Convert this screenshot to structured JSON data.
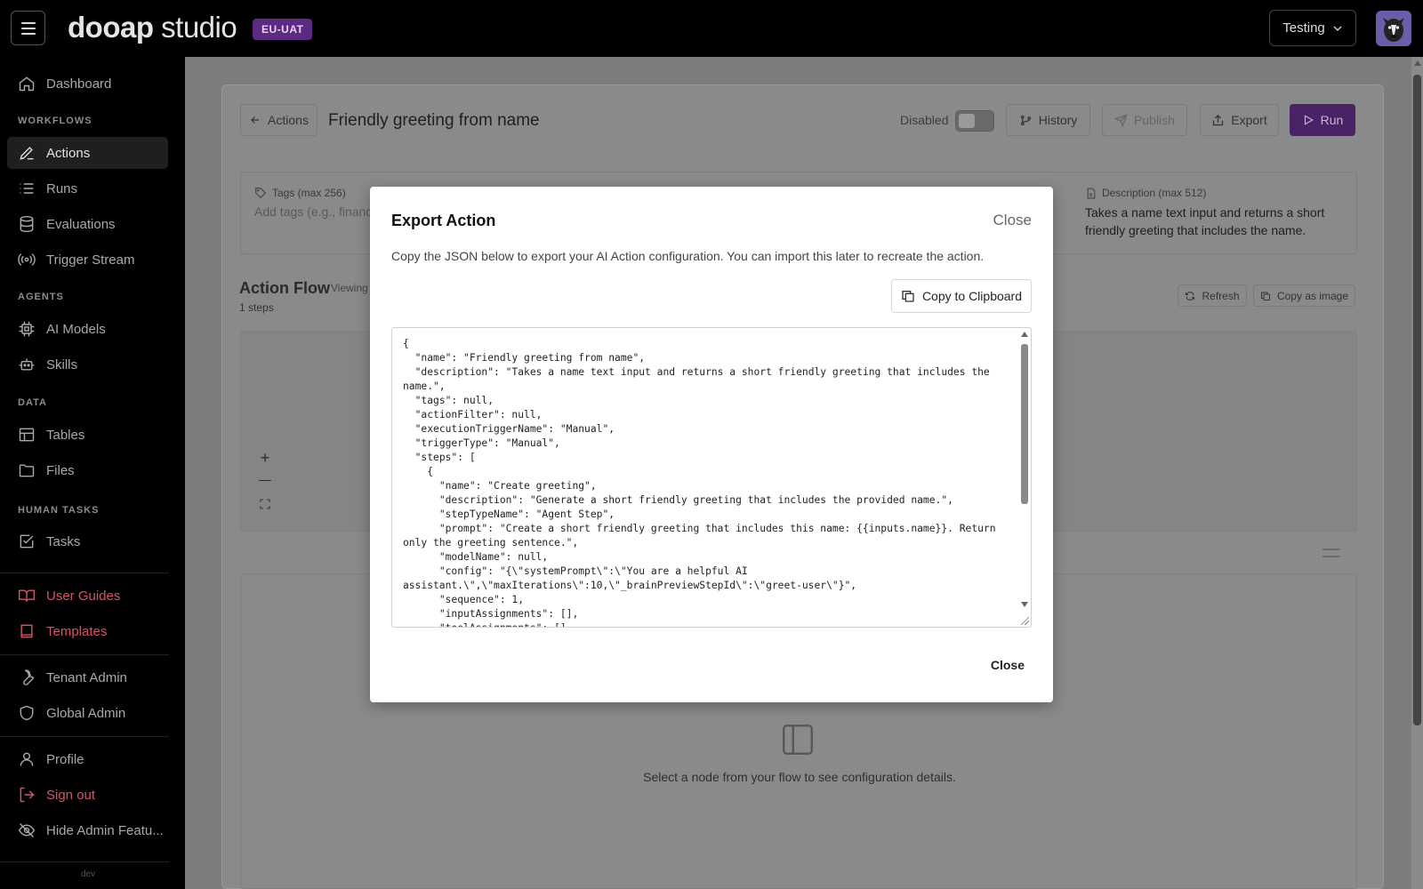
{
  "topbar": {
    "logo_main": "dooap",
    "logo_sub": " studio",
    "env": "EU-UAT",
    "tenant": "Testing"
  },
  "sidebar": {
    "dashboard": "Dashboard",
    "workflows_head": "WORKFLOWS",
    "actions": "Actions",
    "runs": "Runs",
    "evaluations": "Evaluations",
    "trigger_stream": "Trigger Stream",
    "agents_head": "AGENTS",
    "ai_models": "AI Models",
    "skills": "Skills",
    "data_head": "DATA",
    "tables": "Tables",
    "files": "Files",
    "human_head": "HUMAN TASKS",
    "tasks": "Tasks",
    "user_guides": "User Guides",
    "templates": "Templates",
    "tenant_admin": "Tenant Admin",
    "global_admin": "Global Admin",
    "profile": "Profile",
    "sign_out": "Sign out",
    "hide_admin": "Hide Admin Featu...",
    "version": "dev"
  },
  "page": {
    "back_label": "Actions",
    "title": "Friendly greeting from name",
    "disabled_label": "Disabled",
    "history": "History",
    "publish": "Publish",
    "export": "Export",
    "run": "Run",
    "tags_label": "Tags (max 256)",
    "tags_placeholder": "Add tags (e.g., financ",
    "desc_label": "Description (max 512)",
    "desc_value": "Takes a name text input and returns a short friendly greeting that includes the name.",
    "flow_title": "Action Flow",
    "flow_viewing": "Viewing",
    "flow_steps": "1 steps",
    "refresh": "Refresh",
    "copy_image": "Copy as image",
    "zoom_in": "+",
    "zoom_out": "—",
    "empty_detail": "Select a node from your flow to see configuration details."
  },
  "modal": {
    "title": "Export Action",
    "close_top": "Close",
    "description": "Copy the JSON below to export your AI Action configuration. You can import this later to recreate the action.",
    "copy_label": "Copy to Clipboard",
    "json": "{\n  \"name\": \"Friendly greeting from name\",\n  \"description\": \"Takes a name text input and returns a short friendly greeting that includes the name.\",\n  \"tags\": null,\n  \"actionFilter\": null,\n  \"executionTriggerName\": \"Manual\",\n  \"triggerType\": \"Manual\",\n  \"steps\": [\n    {\n      \"name\": \"Create greeting\",\n      \"description\": \"Generate a short friendly greeting that includes the provided name.\",\n      \"stepTypeName\": \"Agent Step\",\n      \"prompt\": \"Create a short friendly greeting that includes this name: {{inputs.name}}. Return only the greeting sentence.\",\n      \"modelName\": null,\n      \"config\": \"{\\\"systemPrompt\\\":\\\"You are a helpful AI assistant.\\\",\\\"maxIterations\\\":10,\\\"_brainPreviewStepId\\\":\\\"greet-user\\\"}\",\n      \"sequence\": 1,\n      \"inputAssignments\": [],\n      \"toolAssignments\": [],",
    "close_bottom": "Close"
  }
}
